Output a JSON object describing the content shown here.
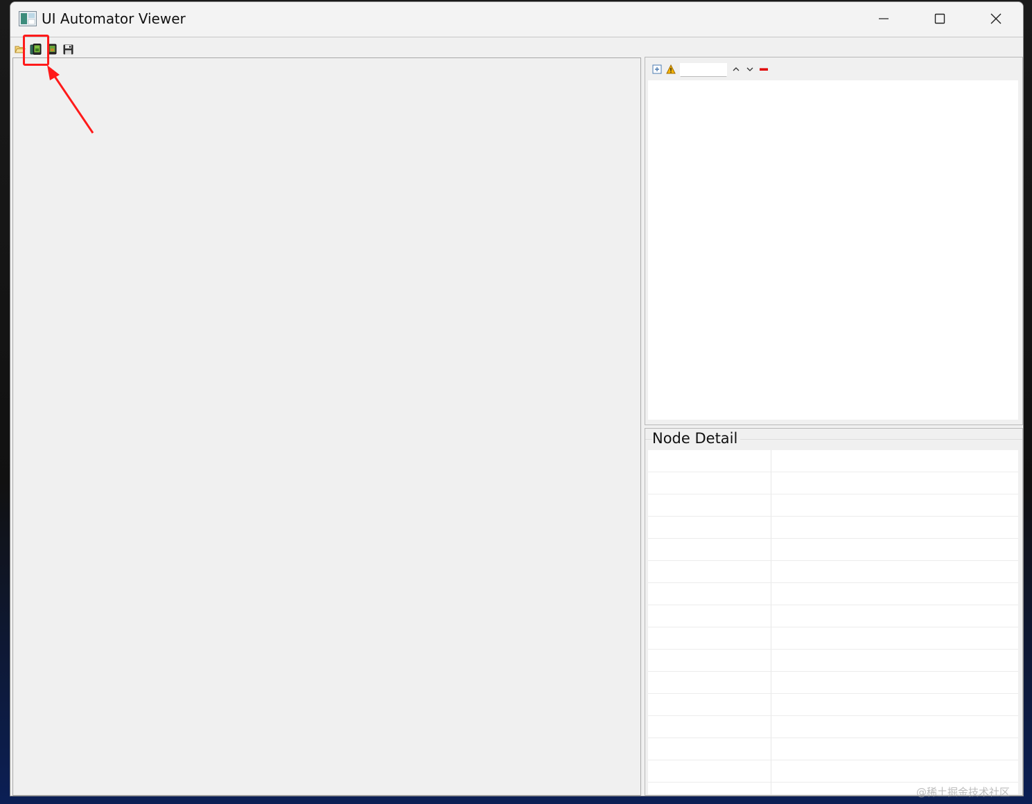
{
  "window": {
    "title": "UI Automator Viewer",
    "icons": {
      "app": "app-window-icon",
      "minimize": "minimize-icon",
      "maximize": "maximize-icon",
      "close": "close-icon"
    }
  },
  "toolbar": {
    "items": [
      {
        "name": "open-icon"
      },
      {
        "name": "device-screenshot-icon"
      },
      {
        "name": "device-screenshot-compressed-icon"
      },
      {
        "name": "save-icon"
      }
    ]
  },
  "tree_panel": {
    "toolbar_icons": [
      "expand-all-icon",
      "warning-icon",
      "search-input",
      "previous-icon",
      "next-icon",
      "clear-icon"
    ],
    "search_value": ""
  },
  "node_detail": {
    "title": "Node Detail",
    "row_count": 16
  },
  "annotation": {
    "color": "#ff1a1a"
  },
  "watermark": {
    "text": "@稀土掘金技术社区"
  }
}
